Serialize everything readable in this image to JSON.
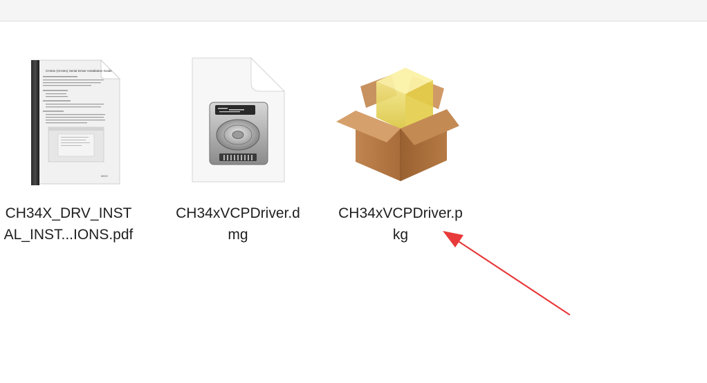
{
  "files": [
    {
      "name_line1": "CH34X_DRV_INST",
      "name_line2": "AL_INST...IONS.pdf",
      "icon": "pdf-document-icon"
    },
    {
      "name_line1": "CH34xVCPDriver.d",
      "name_line2": "mg",
      "icon": "disk-image-icon"
    },
    {
      "name_line1": "CH34xVCPDriver.p",
      "name_line2": "kg",
      "icon": "installer-package-icon"
    }
  ],
  "pdf_preview": {
    "heading": "CH34x (CH34x) Serial Driver Installation Guide",
    "footer_mark": "WCH"
  },
  "annotation": {
    "color": "#e83a3a"
  }
}
